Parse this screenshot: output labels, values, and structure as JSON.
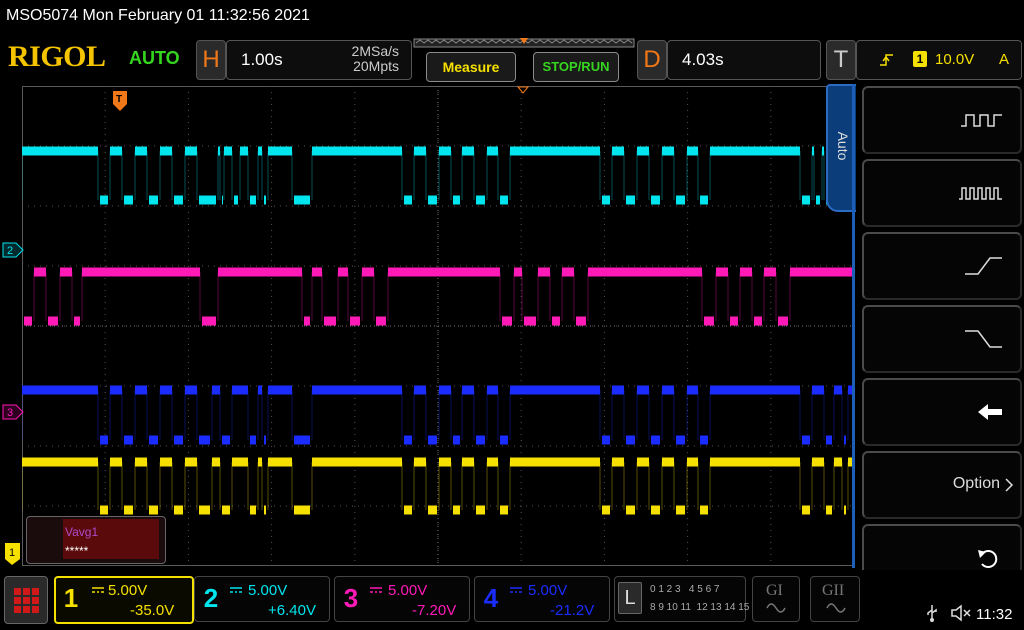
{
  "title_bar": {
    "text": "MSO5074  Mon February 01 11:32:56 2021"
  },
  "brand": {
    "logo": "RIGOL",
    "mode": "AUTO"
  },
  "horizontal": {
    "letter": "H",
    "timebase": "1.00s",
    "sample_rate": "2MSa/s",
    "memory_depth": "20Mpts"
  },
  "buttons": {
    "measure": "Measure",
    "stop_run": "STOP/RUN"
  },
  "delay": {
    "letter": "D",
    "value": "4.03s"
  },
  "trigger": {
    "letter": "T",
    "source": "1",
    "level": "10.0V",
    "channel_tag": "A"
  },
  "side_tab": {
    "label": "Auto"
  },
  "side_menu": {
    "option_label": "Option"
  },
  "markers": {
    "trig": "T",
    "ch2": "2",
    "ch3": "3",
    "ch1": "1"
  },
  "measure_box": {
    "label": "Vavg1",
    "value": "*****"
  },
  "channels": [
    {
      "num": "1",
      "scale": "5.00V",
      "offset": "-35.0V",
      "color": "#f5e000"
    },
    {
      "num": "2",
      "scale": "5.00V",
      "offset": "+6.40V",
      "color": "#00e5ee"
    },
    {
      "num": "3",
      "scale": "5.00V",
      "offset": "-7.20V",
      "color": "#ff1ab8"
    },
    {
      "num": "4",
      "scale": "5.00V",
      "offset": "-21.2V",
      "color": "#1a2cff"
    }
  ],
  "logic": {
    "letter": "L",
    "row1": "0 1 2 3   4 5 6 7",
    "row2": "8 9 10 11  12 13 14 15"
  },
  "extra_buttons": {
    "g1": "GI",
    "g2": "GII"
  },
  "status": {
    "time": "11:32"
  },
  "colors": {
    "ch1": "#f5e000",
    "ch2": "#00e5ee",
    "ch3": "#ff1ab8",
    "ch4": "#1a2cff",
    "accent": "#f07818"
  }
}
